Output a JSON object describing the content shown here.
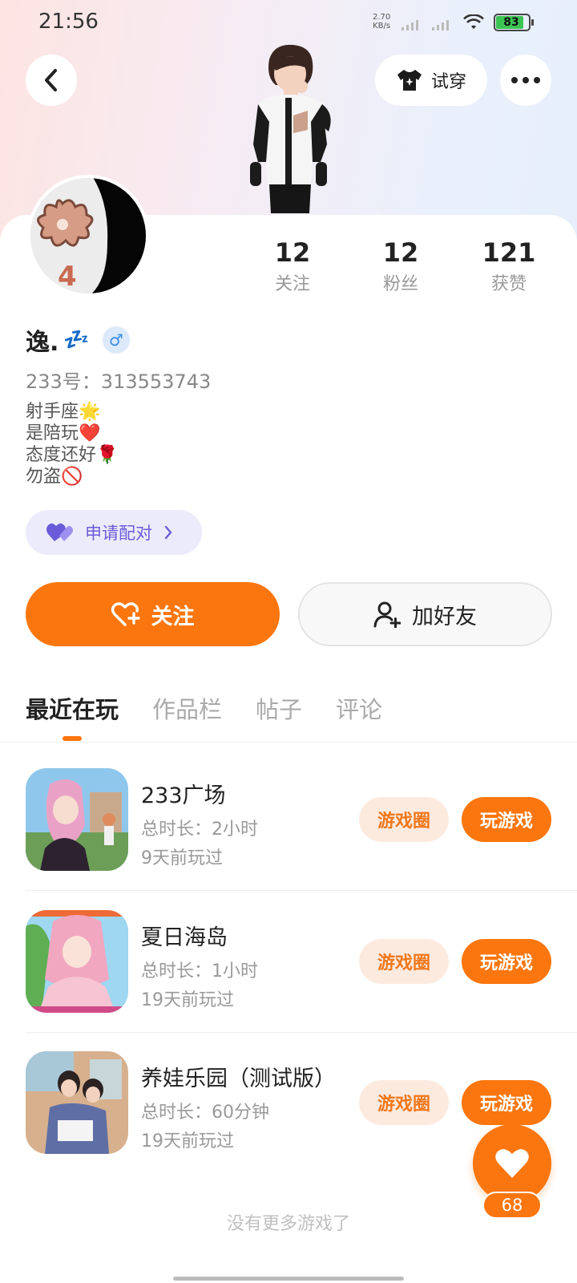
{
  "status_bar": {
    "time": "21:56",
    "net_speed_value": "2.70",
    "net_speed_unit": "KB/s",
    "battery": "83"
  },
  "header": {
    "back_icon": "chevron-left-icon",
    "try_on_label": "试穿",
    "more_icon": "more-dots-icon"
  },
  "stats": [
    {
      "value": "12",
      "label": "关注"
    },
    {
      "value": "12",
      "label": "粉丝"
    },
    {
      "value": "121",
      "label": "获赞"
    }
  ],
  "profile": {
    "name": "逸.",
    "name_emoji": "💤",
    "gender_symbol": "♂",
    "uid": "233号：313553743",
    "bio": [
      "射手座🌟",
      "是陪玩❤️",
      "态度还好🌹",
      "勿盗🚫"
    ]
  },
  "pair_button": {
    "label": "申请配对"
  },
  "actions": {
    "follow_label": "关注",
    "add_friend_label": "加好友"
  },
  "tabs": [
    {
      "label": "最近在玩",
      "active": true
    },
    {
      "label": "作品栏",
      "active": false
    },
    {
      "label": "帖子",
      "active": false
    },
    {
      "label": "评论",
      "active": false
    }
  ],
  "games": [
    {
      "title": "233广场",
      "duration": "总时长：2小时",
      "last_played": "9天前玩过",
      "circle_label": "游戏圈",
      "play_label": "玩游戏"
    },
    {
      "title": "夏日海岛",
      "duration": "总时长：1小时",
      "last_played": "19天前玩过",
      "circle_label": "游戏圈",
      "play_label": "玩游戏"
    },
    {
      "title": "养娃乐园（测试版）",
      "duration": "总时长：60分钟",
      "last_played": "19天前玩过",
      "circle_label": "游戏圈",
      "play_label": "玩游戏"
    }
  ],
  "footer": {
    "no_more": "没有更多游戏了"
  },
  "like_fab": {
    "count": "68"
  },
  "colors": {
    "accent": "#fb760e",
    "accent_light": "#fdeadf",
    "pair_purple": "#6a5cd8"
  }
}
